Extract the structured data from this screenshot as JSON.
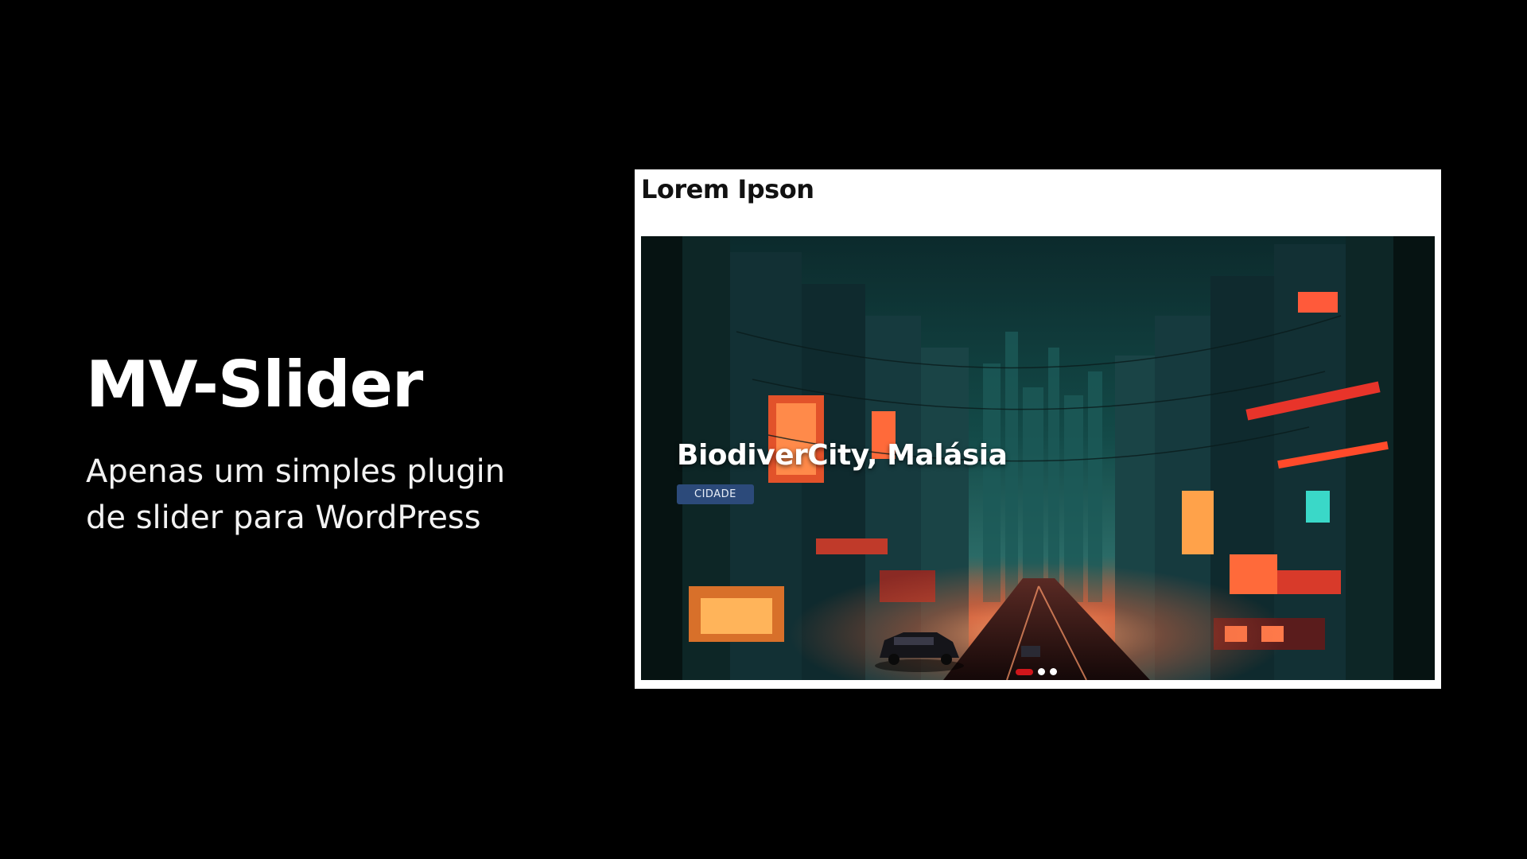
{
  "hero": {
    "title": "MV-Slider",
    "subtitle_line1": "Apenas um simples plugin",
    "subtitle_line2": "de slider para WordPress"
  },
  "preview": {
    "heading": "Lorem Ipson",
    "slide": {
      "title": "BiodiverCity, Malásia",
      "button_label": "CIDADE",
      "image_icon": "cyberpunk-city-street-image"
    },
    "pagination": {
      "total": 3,
      "active_index": 0
    }
  },
  "colors": {
    "background": "#000000",
    "card": "#ffffff",
    "button": "#2c4a7a",
    "active_dot": "#d0161b"
  }
}
